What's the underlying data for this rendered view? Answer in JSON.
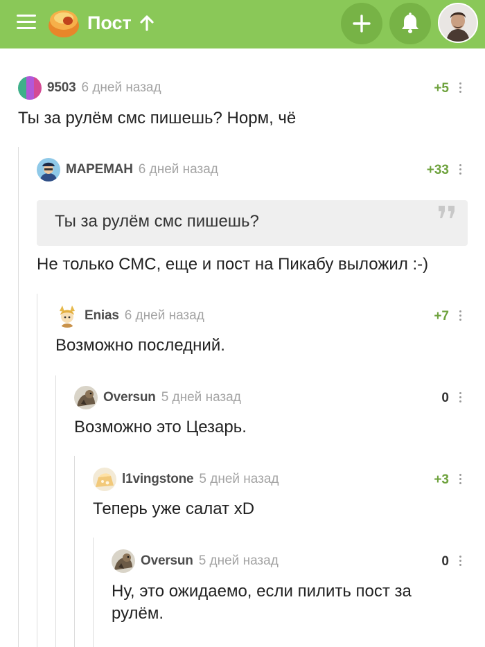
{
  "header": {
    "title": "Пост",
    "colors": {
      "bar": "#8ac858",
      "button": "#77b346"
    },
    "icons": [
      "menu-icon",
      "pikabu-logo",
      "arrow-up-icon",
      "plus-icon",
      "bell-icon",
      "user-avatar"
    ]
  },
  "comments": [
    {
      "author": "9503",
      "time": "6 дней назад",
      "rating": "+5",
      "text": "Ты за рулём смс пишешь? Норм, чё"
    },
    {
      "author": "МАРЕМАН",
      "time": "6 дней назад",
      "rating": "+33",
      "quote": "Ты за рулём смс пишешь?",
      "text": "Не только СМС, еще и пост на Пикабу выложил :-)"
    },
    {
      "author": "Enias",
      "time": "6 дней назад",
      "rating": "+7",
      "text": "Возможно последний."
    },
    {
      "author": "Oversun",
      "time": "5 дней назад",
      "rating": "0",
      "text": "Возможно это Цезарь."
    },
    {
      "author": "l1vingstone",
      "time": "5 дней назад",
      "rating": "+3",
      "text": "Теперь уже салат xD"
    },
    {
      "author": "Oversun",
      "time": "5 дней назад",
      "rating": "0",
      "text_line1": "Ну, это ожидаемо, если пилить пост за",
      "text_line2": "рулём."
    }
  ]
}
